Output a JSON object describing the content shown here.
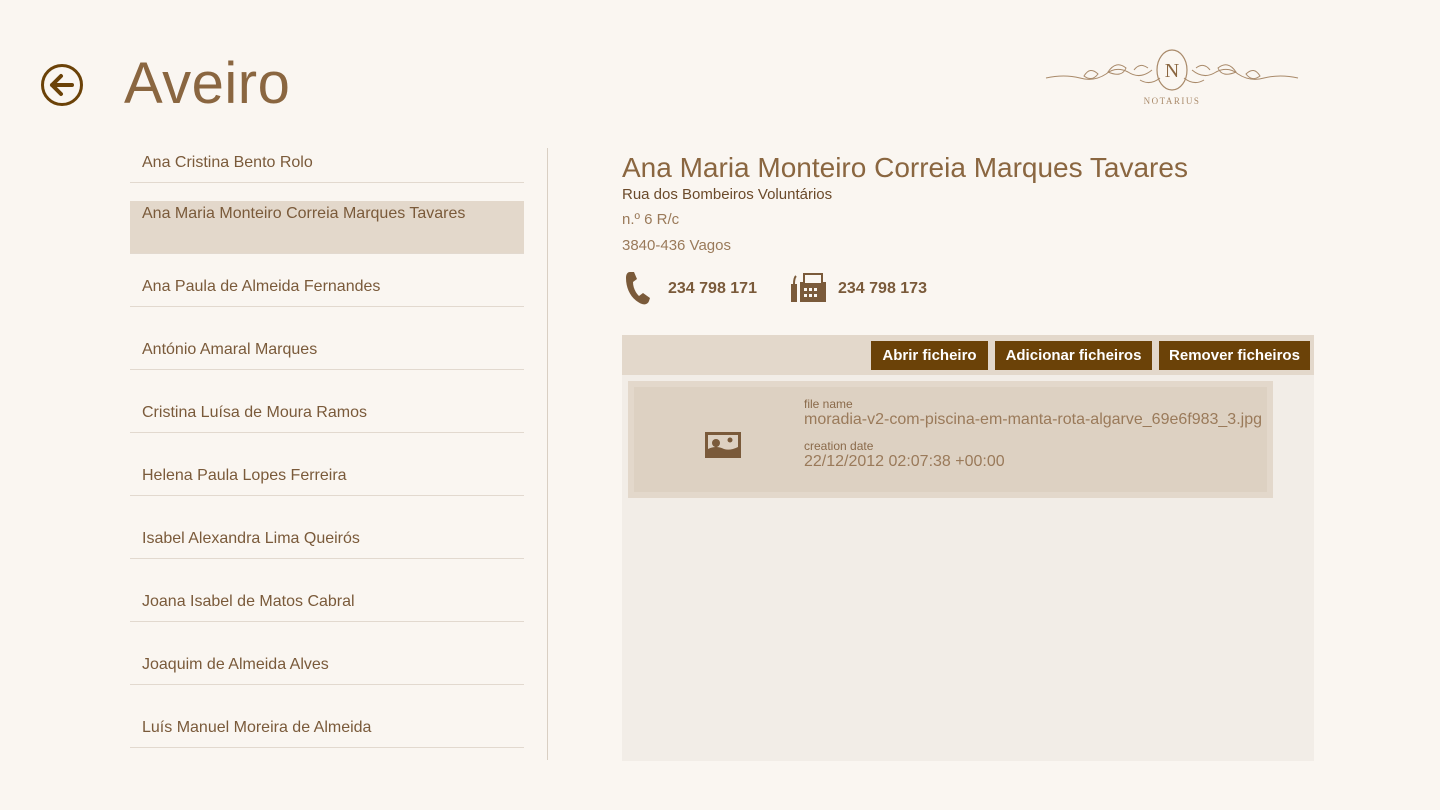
{
  "header": {
    "title": "Aveiro",
    "logo_text": "NOTARIUS"
  },
  "list": {
    "items": [
      "Ana Cristina Bento Rolo",
      "Ana Maria Monteiro Correia Marques Tavares",
      "Ana Paula de Almeida Fernandes",
      "António Amaral Marques",
      "Cristina Luísa de Moura Ramos",
      "Helena Paula Lopes Ferreira",
      "Isabel Alexandra Lima Queirós",
      "Joana Isabel de Matos Cabral",
      "Joaquim de Almeida Alves",
      "Luís Manuel Moreira de Almeida"
    ],
    "selected_index": 1
  },
  "detail": {
    "name": "Ana Maria Monteiro Correia Marques Tavares",
    "street": "Rua dos Bombeiros Voluntários",
    "number": "n.º 6 R/c",
    "postal": "3840-436 Vagos",
    "phone": "234 798 171",
    "fax": "234 798 173"
  },
  "files": {
    "toolbar": {
      "open_label": "Abrir ficheiro",
      "add_label": "Adicionar ficheiros",
      "remove_label": "Remover ficheiros"
    },
    "items": [
      {
        "file_name_label": "file name",
        "file_name": "moradia-v2-com-piscina-em-manta-rota-algarve_69e6f983_3.jpg",
        "creation_date_label": "creation date",
        "creation_date": "22/12/2012 02:07:38 +00:00"
      }
    ]
  },
  "colors": {
    "background": "#faf6f1",
    "accent": "#6b4208",
    "selection": "#e3d8cb",
    "text": "#7a5a3a"
  }
}
